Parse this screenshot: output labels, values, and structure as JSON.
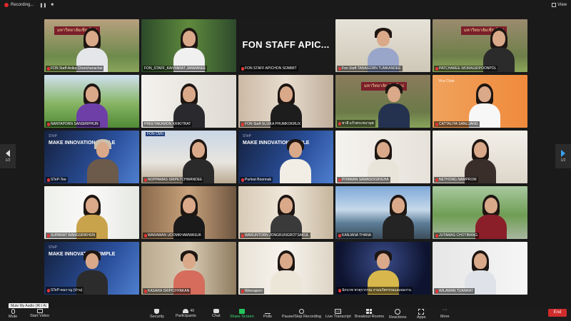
{
  "recording": {
    "label": "Recording..."
  },
  "view": {
    "label": "View"
  },
  "paging": {
    "left": "1/2",
    "right": "1/2"
  },
  "tooltip": "Mute My Audio (⌘⇧A)",
  "participants_count": "49",
  "end_label": "End",
  "overlays": {
    "big_text": "FON STAFF APIC...",
    "banner_cmu": "มหาวิทยาลัยเชียงใหม่",
    "step_brand": "STeP",
    "step_slogan": "MAKE INNOVATION SIMPLE",
    "fon_badge": "FON CMU",
    "vc_text": "Vice Chair"
  },
  "toolbar": {
    "mute": "Mute",
    "start_video": "Start Video",
    "security": "Security",
    "participants": "Participants",
    "chat": "Chat",
    "share": "Share Screen",
    "polls": "Polls",
    "record": "Pause/Stop Recording",
    "transcript": "Live Transcript",
    "rooms": "Breakout Rooms",
    "reactions": "Reactions",
    "apps": "Apps",
    "more": "More",
    "cc": "CC"
  },
  "participants": [
    {
      "name": "FON Staff-Anika Chonchanachai"
    },
    {
      "name": "FON_STAFF_KANYARAT JANMANEE"
    },
    {
      "name": "FON STAFF APICHON SOMMIT"
    },
    {
      "name": "Fon Staff-TANAGORN TUMKANDEE"
    },
    {
      "name": "PATCHAREE WORAGIDPOONPOL"
    },
    {
      "name": "NANTAPORN SANSIRIPHUN"
    },
    {
      "name": "PREEYAKAMON KRIKITRAT"
    },
    {
      "name": "FON Staff-SUJIKA PHUMKOKRUX"
    },
    {
      "name": "ชาลี แก้วตระหนานุช"
    },
    {
      "name": "CATTALIYA SANLUANG"
    },
    {
      "name": "STeP-Tee"
    },
    {
      "name": "NOPPAMAS SRIPETCHWANDEE"
    },
    {
      "name": "Purleat Boonnak"
    },
    {
      "name": "PIYAWAN SAWASDISINGHA"
    },
    {
      "name": "NETHONG NAMPROM"
    },
    {
      "name": "SUPARAT WANGSRIKHUN"
    },
    {
      "name": "WARAWAN UDOMKHAMWASUK"
    },
    {
      "name": "WARUNTORN JONGRUNGROTSAKUL"
    },
    {
      "name": "KANJANA THANA"
    },
    {
      "name": "JUTAMAS CHOTIBANG"
    },
    {
      "name": "STeP-คมกาญ (ป่าน)"
    },
    {
      "name": "KASARA SRIPICHYAKAN"
    },
    {
      "name": "Weeraporn"
    },
    {
      "name": "นักบวช ชาตุรวรรณ งานนวัตกรรมและผลงาน"
    },
    {
      "name": "WILAWAN TUANRAT"
    }
  ]
}
